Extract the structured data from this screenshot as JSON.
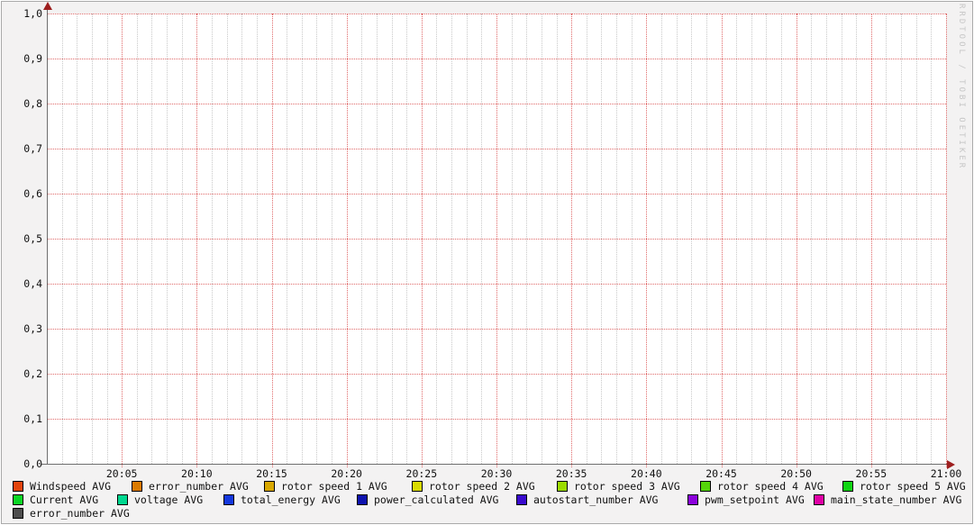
{
  "watermark": "RRDTOOL / TOBI OETIKER",
  "chart_data": {
    "type": "line",
    "title": "",
    "xlabel": "",
    "ylabel": "",
    "grid": true,
    "legend_position": "bottom",
    "x_axis": {
      "start": "20:00",
      "end": "21:00",
      "tick_labels": [
        "20:05",
        "20:10",
        "20:15",
        "20:20",
        "20:25",
        "20:30",
        "20:35",
        "20:40",
        "20:45",
        "20:50",
        "20:55",
        "21:00"
      ],
      "minor_ticks_per_major": 5
    },
    "y_axis": {
      "min": 0.0,
      "max": 1.0,
      "tick_step": 0.1,
      "tick_labels_top_to_bottom": [
        "1,0",
        "0,9",
        "0,8",
        "0,7",
        "0,6",
        "0,5",
        "0,4",
        "0,3",
        "0,2",
        "0,1",
        "0,0"
      ]
    },
    "series": [
      {
        "name": "Windspeed AVG",
        "color": "#e2440d",
        "values": []
      },
      {
        "name": "error_number AVG",
        "color": "#db7a00",
        "values": []
      },
      {
        "name": "rotor speed 1 AVG",
        "color": "#d9a800",
        "values": []
      },
      {
        "name": "rotor speed 2 AVG",
        "color": "#d9db00",
        "values": []
      },
      {
        "name": "rotor speed 3 AVG",
        "color": "#9bdb00",
        "values": []
      },
      {
        "name": "rotor speed 4 AVG",
        "color": "#55d40a",
        "values": []
      },
      {
        "name": "rotor speed 5 AVG",
        "color": "#0fd412",
        "values": []
      },
      {
        "name": "Current AVG",
        "color": "#0bd626",
        "values": []
      },
      {
        "name": "voltage AVG",
        "color": "#00d78f",
        "values": []
      },
      {
        "name": "total_energy AVG",
        "color": "#1438de",
        "values": []
      },
      {
        "name": "power_calculated AVG",
        "color": "#0e12ae",
        "values": []
      },
      {
        "name": "autostart_number AVG",
        "color": "#3a0ace",
        "values": []
      },
      {
        "name": "pwm_setpoint AVG",
        "color": "#8c00dc",
        "values": []
      },
      {
        "name": "main_state_number AVG",
        "color": "#e000a6",
        "values": []
      },
      {
        "name": "error_number AVG",
        "color": "#4d4d4d",
        "values": []
      }
    ]
  },
  "legend": {
    "rows": [
      {
        "items": [
          {
            "label": "Windspeed AVG",
            "color": "#e2440d"
          },
          {
            "label": "error_number AVG",
            "color": "#db7a00"
          },
          {
            "label": "rotor speed 1 AVG",
            "color": "#d9a800"
          },
          {
            "label": "rotor speed 2 AVG",
            "color": "#d9db00"
          },
          {
            "label": "rotor speed 3 AVG",
            "color": "#9bdb00"
          },
          {
            "label": "rotor speed 4 AVG",
            "color": "#55d40a"
          },
          {
            "label": "rotor speed 5 AVG",
            "color": "#0fd412"
          }
        ]
      },
      {
        "items": [
          {
            "label": "Current AVG",
            "color": "#0bd626"
          },
          {
            "label": "voltage AVG",
            "color": "#00d78f"
          },
          {
            "label": "total_energy AVG",
            "color": "#1438de"
          },
          {
            "label": "power_calculated AVG",
            "color": "#0e12ae"
          },
          {
            "label": "autostart_number AVG",
            "color": "#3a0ace"
          },
          {
            "label": "pwm_setpoint AVG",
            "color": "#8c00dc"
          },
          {
            "label": "main_state_number AVG",
            "color": "#e000a6"
          }
        ]
      },
      {
        "items": [
          {
            "label": "error_number AVG",
            "color": "#4d4d4d"
          }
        ]
      }
    ]
  },
  "grid_colors": {
    "major": "#e06a6a",
    "minor": "#c9c9c9",
    "axis": "#6e6e6e",
    "arrow": "#9e1f1f"
  }
}
